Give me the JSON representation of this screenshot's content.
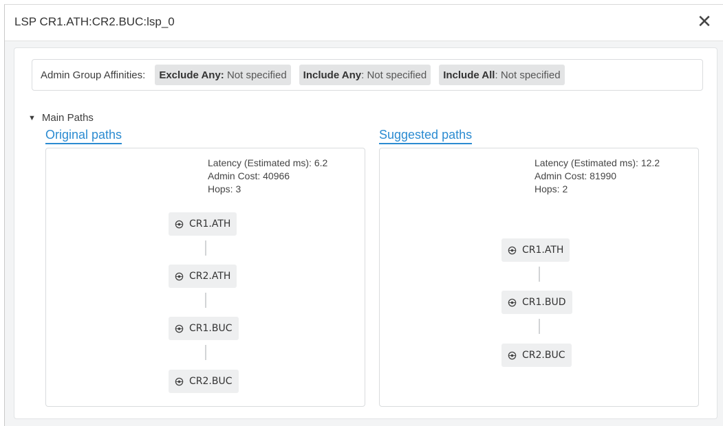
{
  "dialog": {
    "title": "LSP CR1.ATH:CR2.BUC:lsp_0",
    "close_symbol": "✕"
  },
  "affinities": {
    "label": "Admin Group Affinities:",
    "exclude_any": {
      "key": "Exclude Any:",
      "value": " Not specified"
    },
    "include_any": {
      "key": "Include Any",
      "value": ": Not specified"
    },
    "include_all": {
      "key": "Include All",
      "value": ": Not specified"
    }
  },
  "main_paths": {
    "toggle_arrow": "▼",
    "label": "Main Paths",
    "original": {
      "title": "Original paths",
      "latency": "Latency (Estimated ms): 6.2",
      "admin_cost": "Admin Cost: 40966",
      "hops": "Hops: 3",
      "nodes": [
        "CR1.ATH",
        "CR2.ATH",
        "CR1.BUC",
        "CR2.BUC"
      ]
    },
    "suggested": {
      "title": "Suggested paths",
      "latency": "Latency (Estimated ms): 12.2",
      "admin_cost": "Admin Cost: 81990",
      "hops": "Hops: 2",
      "nodes": [
        "CR1.ATH",
        "CR1.BUD",
        "CR2.BUC"
      ]
    }
  },
  "icons": {
    "router": "router-icon",
    "close": "close-icon",
    "collapse": "caret-down-icon"
  },
  "colors": {
    "link_blue": "#2b8bd1",
    "chip_bg": "#e3e4e5",
    "node_bg": "#eeeff0"
  }
}
